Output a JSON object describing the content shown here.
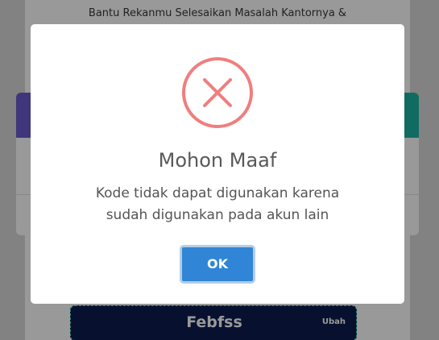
{
  "background": {
    "subtitle": "Bantu Rekanmu Selesaikan Masalah Kantornya &",
    "code_value": "Febfss",
    "code_edit_label": "Ubah"
  },
  "alert": {
    "icon": "error-x-icon",
    "title": "Mohon Maaf",
    "message_line1": "Kode tidak dapat digunakan karena",
    "message_line2": "sudah digunakan pada akun lain",
    "ok_label": "OK"
  },
  "colors": {
    "error_icon": "#f07e7e",
    "ok_button": "#3085d6",
    "code_box": "#0d1b4f",
    "code_border": "#3ed6a3",
    "header_purple": "#6a5acd",
    "header_teal": "#1cb5a6"
  }
}
